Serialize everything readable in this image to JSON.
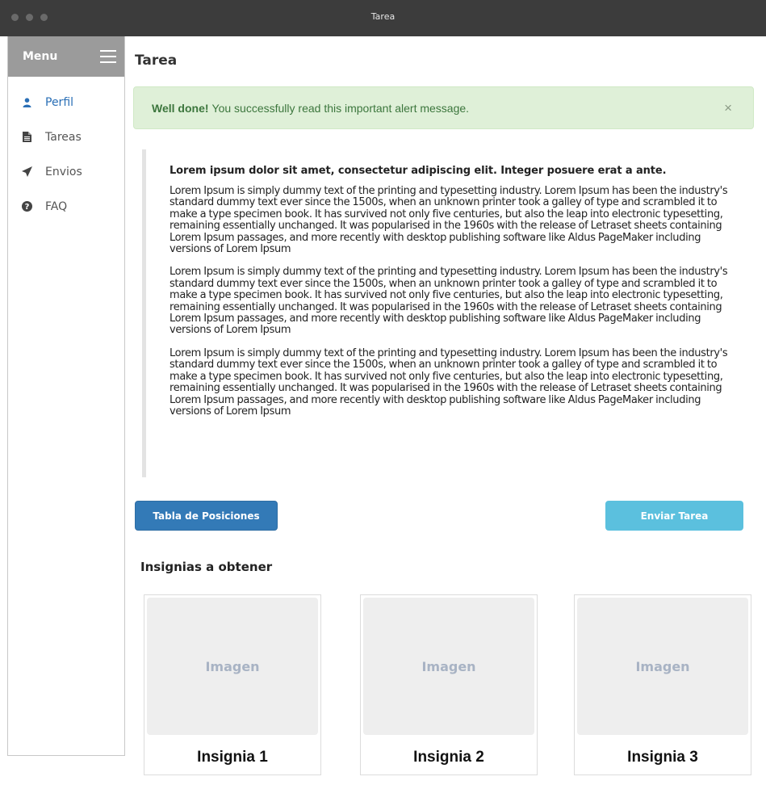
{
  "window": {
    "title": "Tarea"
  },
  "sidebar": {
    "header_label": "Menu",
    "items": [
      {
        "label": "Perfil",
        "icon": "user-icon",
        "active": true
      },
      {
        "label": "Tareas",
        "icon": "file-icon",
        "active": false
      },
      {
        "label": "Envios",
        "icon": "send-icon",
        "active": false
      },
      {
        "label": "FAQ",
        "icon": "question-circle-icon",
        "active": false
      }
    ]
  },
  "main": {
    "title": "Tarea",
    "alert": {
      "strong": "Well done!",
      "message": "You successfully read this important alert message.",
      "close": "×"
    },
    "quote": {
      "lead": "Lorem ipsum dolor sit amet, consectetur adipiscing elit. Integer posuere erat a ante.",
      "paragraphs": [
        "Lorem Ipsum is simply dummy text of the printing and typesetting industry. Lorem Ipsum has been the industry's standard dummy text ever since the 1500s, when an unknown printer took a galley of type and scrambled it to make a type specimen book. It has survived not only five centuries, but also the leap into electronic typesetting, remaining essentially unchanged. It was popularised in the 1960s with the release of Letraset sheets containing Lorem Ipsum passages, and more recently with desktop publishing software like Aldus PageMaker including versions of Lorem Ipsum",
        "Lorem Ipsum is simply dummy text of the printing and typesetting industry. Lorem Ipsum has been the industry's standard dummy text ever since the 1500s, when an unknown printer took a galley of type and scrambled it to make a type specimen book. It has survived not only five centuries, but also the leap into electronic typesetting, remaining essentially unchanged. It was popularised in the 1960s with the release of Letraset sheets containing Lorem Ipsum passages, and more recently with desktop publishing software like Aldus PageMaker including versions of Lorem Ipsum",
        "Lorem Ipsum is simply dummy text of the printing and typesetting industry. Lorem Ipsum has been the industry's standard dummy text ever since the 1500s, when an unknown printer took a galley of type and scrambled it to make a type specimen book. It has survived not only five centuries, but also the leap into electronic typesetting, remaining essentially unchanged. It was popularised in the 1960s with the release of Letraset sheets containing Lorem Ipsum passages, and more recently with desktop publishing software like Aldus PageMaker including versions of Lorem Ipsum"
      ]
    },
    "buttons": {
      "standings": "Tabla de Posiciones",
      "submit": "Enviar Tarea"
    },
    "badges": {
      "title": "Insignias a obtener",
      "items": [
        {
          "image_text": "Imagen",
          "name": "Insignia 1"
        },
        {
          "image_text": "Imagen",
          "name": "Insignia 2"
        },
        {
          "image_text": "Imagen",
          "name": "Insignia 3"
        }
      ]
    }
  },
  "colors": {
    "active_nav": "#2a6fb6",
    "primary_button": "#337ab7",
    "info_button": "#5bc0de",
    "alert_bg": "#dff0d8",
    "alert_text": "#3c763d"
  }
}
